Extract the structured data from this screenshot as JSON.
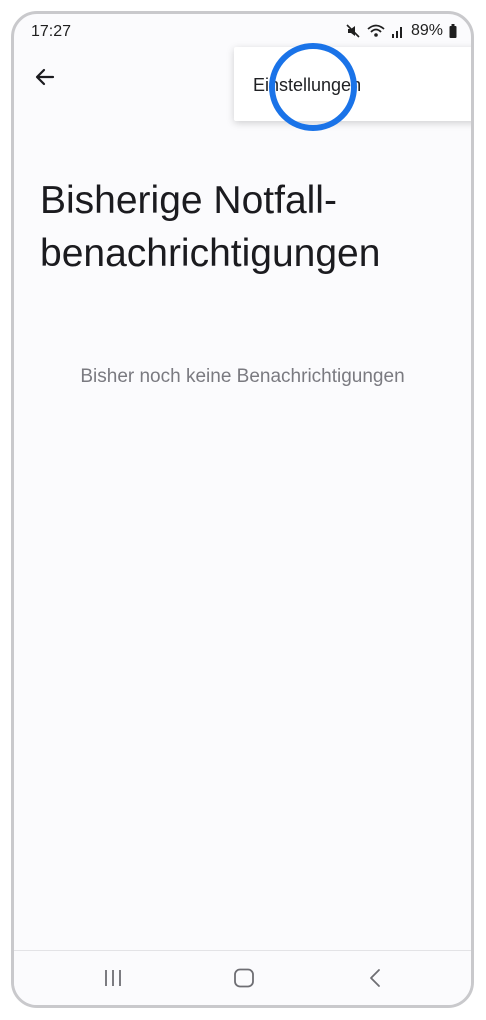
{
  "status_bar": {
    "time": "17:27",
    "battery": "89%",
    "icons": [
      "mute-icon",
      "wifi-icon",
      "signal-icon",
      "battery-icon"
    ]
  },
  "toolbar": {
    "back_icon": "arrow-left-icon"
  },
  "overflow_menu": {
    "items": [
      {
        "label": "Einstellungen"
      }
    ]
  },
  "page": {
    "title": "Bisherige Notfall-benachrichtigungen",
    "empty_message": "Bisher noch keine Benachrichtigungen"
  },
  "nav_bar": {
    "icons": [
      "recents-icon",
      "home-icon",
      "back-icon"
    ]
  },
  "colors": {
    "highlight": "#1a73e8",
    "background": "#fbfbfd",
    "text_primary": "#1b1b1f",
    "text_secondary": "#7a7a80"
  }
}
